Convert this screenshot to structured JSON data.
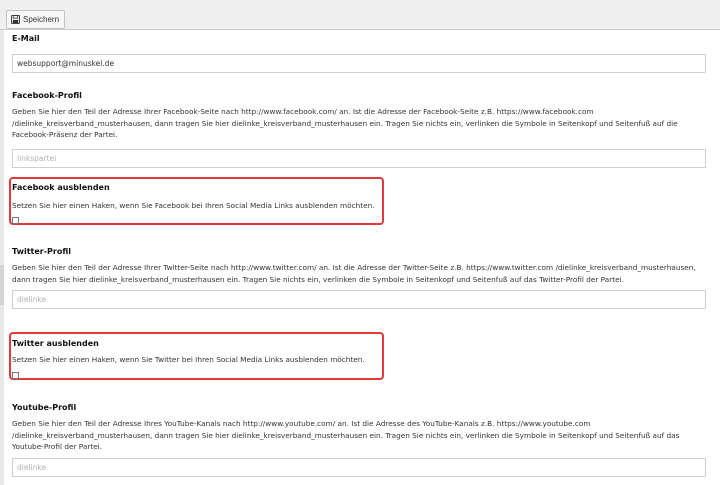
{
  "toolbar": {
    "save_label": "Speichern"
  },
  "fields": {
    "email": {
      "label": "E-Mail",
      "value": "websupport@minuskel.de"
    },
    "facebook_profile": {
      "label": "Facebook-Profil",
      "description": "Geben Sie hier den Teil der Adresse Ihrer Facebook-Seite nach http://www.facebook.com/ an. Ist die Adresse der Facebook-Seite z.B. https://www.facebook.com /dielinke_kreisverband_musterhausen, dann tragen Sie hier dielinke_kreisverband_musterhausen ein. Tragen Sie nichts ein, verlinken die Symbole in Seitenkopf und Seitenfuß auf die Facebook-Präsenz der Partei.",
      "placeholder": "linkspartei"
    },
    "facebook_hide": {
      "label": "Facebook ausblenden",
      "description": "Setzen Sie hier einen Haken, wenn Sie Facebook bei Ihren Social Media Links ausblenden möchten."
    },
    "twitter_profile": {
      "label": "Twitter-Profil",
      "description": "Geben Sie hier den Teil der Adresse Ihrer Twitter-Seite nach http://www.twitter.com/ an. Ist die Adresse der Twitter-Seite z.B. https://www.twitter.com /dielinke_kreisverband_musterhausen, dann tragen Sie hier dielinke_kreisverband_musterhausen ein. Tragen Sie nichts ein, verlinken die Symbole in Seitenkopf und Seitenfuß auf das Twitter-Profil der Partei.",
      "placeholder": "dielinke"
    },
    "twitter_hide": {
      "label": "Twitter ausblenden",
      "description": "Setzen Sie hier einen Haken, wenn Sie Twitter bei Ihren Social Media Links ausblenden möchten."
    },
    "youtube_profile": {
      "label": "Youtube-Profil",
      "description": "Geben Sie hier den Teil der Adresse Ihres YouTube-Kanals nach http://www.youtube.com/ an. Ist die Adresse des YouTube-Kanals z.B. https://www.youtube.com /dielinke_kreisverband_musterhausen, dann tragen Sie hier dielinke_kreisverband_musterhausen ein. Tragen Sie nichts ein, verlinken die Symbole in Seitenkopf und Seitenfuß auf das Youtube-Profil der Partei.",
      "placeholder": "dielinke"
    }
  },
  "colors": {
    "highlight": "#e03a3a",
    "toolbar_bg": "#efefef"
  }
}
